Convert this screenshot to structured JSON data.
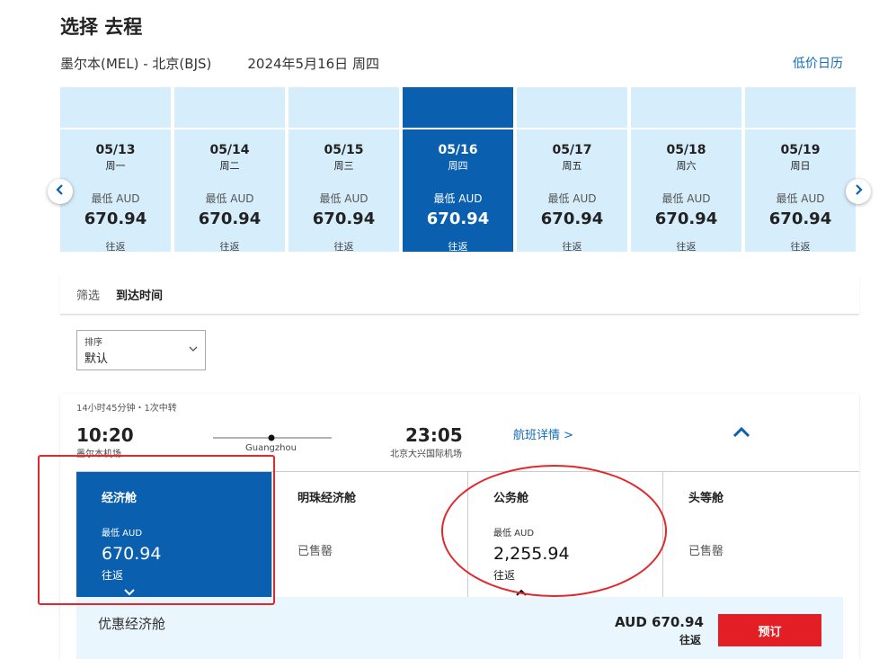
{
  "header": {
    "title": "选择 去程",
    "route": "墨尔本(MEL) - 北京(BJS)",
    "date": "2024年5月16日 周四",
    "low_price_calendar": "低价日历"
  },
  "date_strip": {
    "days": [
      {
        "md": "05/13",
        "wd": "周一",
        "label": "最低 AUD",
        "price": "670.94",
        "rt": "往返"
      },
      {
        "md": "05/14",
        "wd": "周二",
        "label": "最低 AUD",
        "price": "670.94",
        "rt": "往返"
      },
      {
        "md": "05/15",
        "wd": "周三",
        "label": "最低 AUD",
        "price": "670.94",
        "rt": "往返"
      },
      {
        "md": "05/16",
        "wd": "周四",
        "label": "最低 AUD",
        "price": "670.94",
        "rt": "往返"
      },
      {
        "md": "05/17",
        "wd": "周五",
        "label": "最低 AUD",
        "price": "670.94",
        "rt": "往返"
      },
      {
        "md": "05/18",
        "wd": "周六",
        "label": "最低 AUD",
        "price": "670.94",
        "rt": "往返"
      },
      {
        "md": "05/19",
        "wd": "周日",
        "label": "最低 AUD",
        "price": "670.94",
        "rt": "往返"
      }
    ],
    "prev_icon": "chevron-left-icon",
    "next_icon": "chevron-right-icon"
  },
  "filter": {
    "label": "筛选",
    "active": "到达时间"
  },
  "sort": {
    "label": "排序",
    "value": "默认"
  },
  "flight": {
    "duration": "14小时45分钟・1次中转",
    "depart_time": "10:20",
    "depart_airport": "墨尔本机场",
    "via": "Guangzhou",
    "arrive_time": "23:05",
    "arrive_airport": "北京大兴国际机场",
    "details_link": "航班详情 >",
    "cabins": [
      {
        "name": "经济舱",
        "lowest": "最低 AUD",
        "amount": "670.94",
        "rt": "往返"
      },
      {
        "name": "明珠经济舱",
        "sold": "已售罄"
      },
      {
        "name": "公务舱",
        "lowest": "最低 AUD",
        "amount": "2,255.94",
        "rt": "往返"
      },
      {
        "name": "头等舱",
        "sold": "已售罄"
      }
    ],
    "fare": {
      "name": "优惠经济舱",
      "price": "AUD 670.94",
      "rt": "往返",
      "book": "预订"
    }
  },
  "colors": {
    "brand_blue": "#0a5fae",
    "light_blue": "#d6edfb",
    "book_red": "#e31e24",
    "annotation_red": "#e0282d"
  }
}
